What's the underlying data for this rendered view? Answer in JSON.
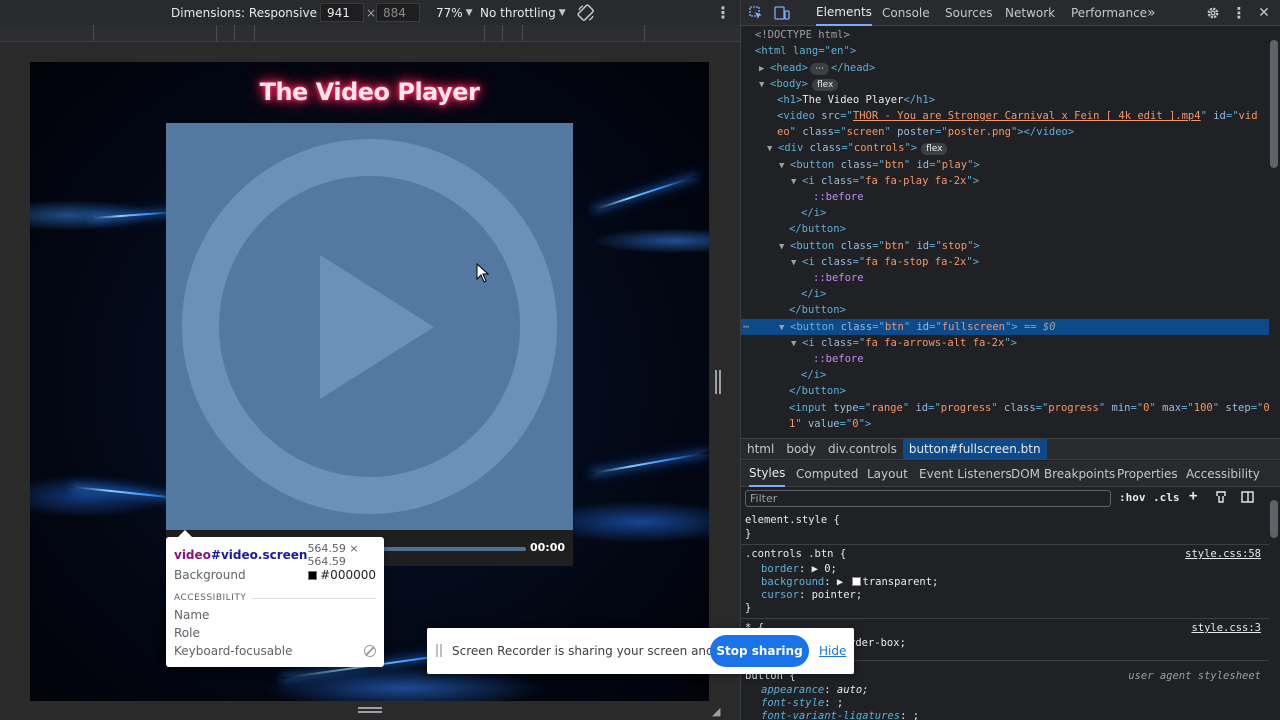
{
  "device_toolbar": {
    "dimensions_label": "Dimensions: Responsive",
    "width_value": "941",
    "height_value": "884",
    "dim_separator": "×",
    "zoom": "77%",
    "throttling": "No throttling"
  },
  "page": {
    "title": "The Video Player",
    "time": "00:00"
  },
  "inspect_tooltip": {
    "selector_tag": "video",
    "selector_id": "#video.screen",
    "size": "564.59 × 564.59",
    "background_label": "Background",
    "background_value": "#000000",
    "section": "ACCESSIBILITY",
    "name_label": "Name",
    "role_label": "Role",
    "keyboard_label": "Keyboard-focusable"
  },
  "recorder": {
    "message": "Screen Recorder is sharing your screen and audio.",
    "stop_label": "Stop sharing",
    "hide_label": "Hide"
  },
  "devtools": {
    "tabs": [
      "Elements",
      "Console",
      "Sources",
      "Network",
      "Performance"
    ],
    "more": "»",
    "dom": {
      "l0": "<!DOCTYPE html>",
      "html_open": "<html lang=\"en\">",
      "head": "<head>",
      "head_close": "</head>",
      "body": "<body>",
      "flex": "flex",
      "h1_text": "The Video Player",
      "video_src": "THOR - You are Stronger   Carnival x Fein [ 4k edit ].mp4",
      "video_id_part1": "vid",
      "video_id_part2": "eo",
      "video_class": "screen",
      "video_poster": "poster.png",
      "controls_class": "controls",
      "play_btn_class": "btn",
      "play_btn_id": "play",
      "play_icon_class": "fa fa-play fa-2x",
      "before": "::before",
      "stop_btn_id": "stop",
      "stop_icon_class": "fa fa-stop fa-2x",
      "fs_btn_id": "fullscreen",
      "eq0": "== $0",
      "fs_icon_class": "fa fa-arrows-alt fa-2x",
      "progress_type": "range",
      "progress_id": "progress",
      "progress_class": "progress",
      "progress_min": "0",
      "progress_max": "100",
      "progress_step": "0.",
      "progress_step2": "1",
      "progress_value": "0"
    },
    "breadcrumb": [
      "html",
      "body",
      "div.controls",
      "button#fullscreen.btn"
    ],
    "styles_tabs": [
      "Styles",
      "Computed",
      "Layout",
      "Event Listeners",
      "DOM Breakpoints",
      "Properties",
      "Accessibility"
    ],
    "filter_placeholder": "Filter",
    "filter_hov": ":hov",
    "filter_cls": ".cls",
    "styles": {
      "element_style": "element.style {",
      "close_brace": "}",
      "rule1_selector": ".controls .btn {",
      "rule1_src": "style.css:58",
      "border_prop": "border",
      "border_val": "0;",
      "background_prop": "background",
      "background_val": "transparent;",
      "cursor_prop": "cursor",
      "cursor_val": "pointer;",
      "rule2_selector": "* {",
      "rule2_src": "style.css:3",
      "boxsizing_tail": "rder-box;",
      "ua_selector": "button {",
      "ua_src": "user agent stylesheet",
      "appearance_prop": "appearance",
      "appearance_val": "auto;",
      "fontstyle_prop": "font-style",
      "fontstyle_val": ";",
      "fontvariant_prop": "font-variant-ligatures",
      "fontvariant_val": ";"
    }
  }
}
